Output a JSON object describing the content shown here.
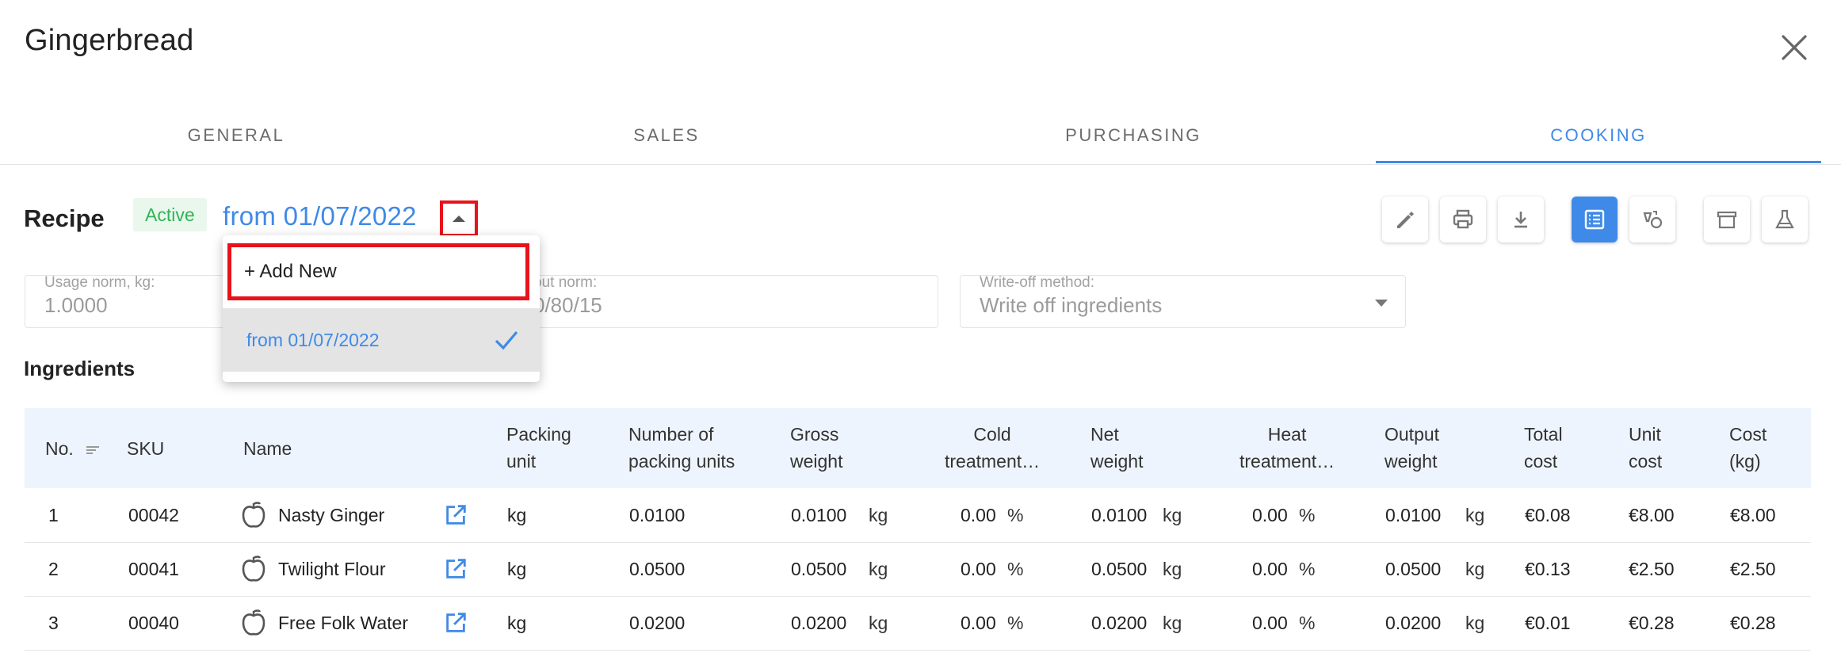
{
  "header": {
    "title": "Gingerbread"
  },
  "tabs": [
    {
      "label": "GENERAL"
    },
    {
      "label": "SALES"
    },
    {
      "label": "PURCHASING"
    },
    {
      "label": "COOKING"
    }
  ],
  "recipe": {
    "label": "Recipe",
    "status": "Active",
    "version": "from 01/07/2022"
  },
  "fields": {
    "usage_norm": {
      "label": "Usage norm, kg:",
      "value": "1.0000"
    },
    "output_norm": {
      "label": "put norm:",
      "value": "0/80/15"
    },
    "write_off": {
      "label": "Write-off method:",
      "value": "Write off ingredients"
    }
  },
  "dropdown": {
    "add_label": "+ Add New",
    "items": [
      {
        "label": "from 01/07/2022",
        "selected": true
      }
    ]
  },
  "ingredients": {
    "title": "Ingredients",
    "columns": {
      "no": "No.",
      "sku": "SKU",
      "name": "Name",
      "packing_unit_1": "Packing",
      "packing_unit_2": "unit",
      "num_units_1": "Number of",
      "num_units_2": "packing units",
      "gross_1": "Gross",
      "gross_2": "weight",
      "cold_1": "Cold",
      "cold_2": "treatment…",
      "net_1": "Net",
      "net_2": "weight",
      "heat_1": "Heat",
      "heat_2": "treatment…",
      "output_1": "Output",
      "output_2": "weight",
      "total_1": "Total",
      "total_2": "cost",
      "unitcost_1": "Unit",
      "unitcost_2": "cost",
      "costkg_1": "Cost",
      "costkg_2": "(kg)"
    },
    "rows": [
      {
        "no": "1",
        "sku": "00042",
        "name": "Nasty Ginger",
        "packing_unit": "kg",
        "num_units": "0.0100",
        "gross": "0.0100",
        "gross_unit": "kg",
        "cold": "0.00",
        "cold_unit": "%",
        "net": "0.0100",
        "net_unit": "kg",
        "heat": "0.00",
        "heat_unit": "%",
        "output": "0.0100",
        "output_unit": "kg",
        "total_cost": "€0.08",
        "unit_cost": "€8.00",
        "cost_kg": "€8.00"
      },
      {
        "no": "2",
        "sku": "00041",
        "name": "Twilight Flour",
        "packing_unit": "kg",
        "num_units": "0.0500",
        "gross": "0.0500",
        "gross_unit": "kg",
        "cold": "0.00",
        "cold_unit": "%",
        "net": "0.0500",
        "net_unit": "kg",
        "heat": "0.00",
        "heat_unit": "%",
        "output": "0.0500",
        "output_unit": "kg",
        "total_cost": "€0.13",
        "unit_cost": "€2.50",
        "cost_kg": "€2.50"
      },
      {
        "no": "3",
        "sku": "00040",
        "name": "Free Folk Water",
        "packing_unit": "kg",
        "num_units": "0.0200",
        "gross": "0.0200",
        "gross_unit": "kg",
        "cold": "0.00",
        "cold_unit": "%",
        "net": "0.0200",
        "net_unit": "kg",
        "heat": "0.00",
        "heat_unit": "%",
        "output": "0.0200",
        "output_unit": "kg",
        "total_cost": "€0.01",
        "unit_cost": "€0.28",
        "cost_kg": "€0.28"
      }
    ]
  },
  "icons": {
    "close": "close-icon",
    "toolbar": [
      "edit-icon",
      "print-icon",
      "download-icon",
      "list-view-icon",
      "reorder-icon",
      "archive-icon",
      "flask-icon"
    ],
    "ingredient": "apple-icon",
    "open": "open-external-icon"
  },
  "colors": {
    "accent": "#3f8ae8",
    "active_badge_bg": "#eaf7ed",
    "active_badge_text": "#2fb457",
    "highlight": "#e8121b"
  }
}
